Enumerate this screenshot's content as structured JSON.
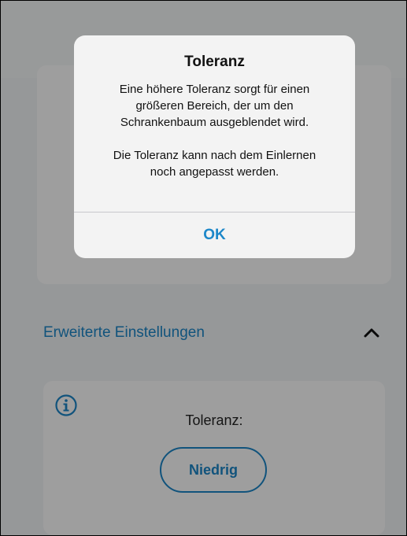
{
  "settings": {
    "advanced_label": "Erweiterte Einstellungen",
    "tolerance_label": "Toleranz:",
    "tolerance_value": "Niedrig"
  },
  "dialog": {
    "title": "Toleranz",
    "message": "Eine höhere Toleranz sorgt für einen\ngrößeren Bereich, der um den\nSchrankenbaum ausgeblendet wird.\n\nDie Toleranz kann nach dem Einlernen\nnoch angepasst werden.",
    "ok_label": "OK"
  },
  "icons": {
    "chevron": "chevron-up-icon",
    "info": "info-circle-icon"
  },
  "colors": {
    "accent": "#1c87c9",
    "dim_overlay": "rgba(0,0,0,0.38)"
  }
}
